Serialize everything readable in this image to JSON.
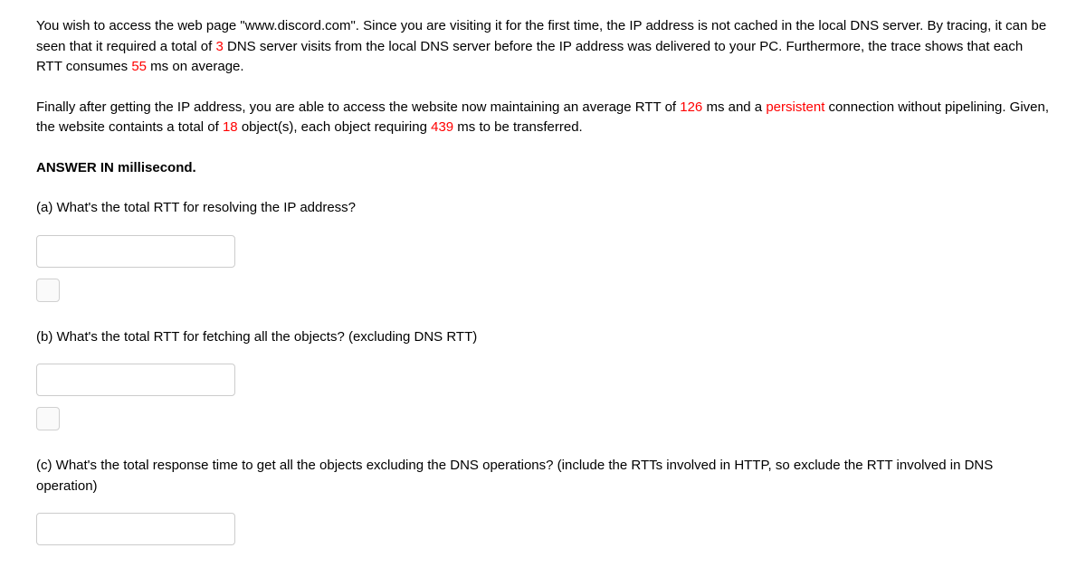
{
  "intro": {
    "p1_a": "You wish to access the web page \"www.discord.com\". Since you are visiting it for the first time, the IP address is not cached in the local DNS server. By tracing, it can be seen that it required a total of ",
    "dns_visits": "3",
    "p1_b": " DNS server visits from the local DNS server before the IP address was delivered to your PC. Furthermore, the trace shows that each RTT consumes ",
    "dns_rtt": "55",
    "p1_c": " ms on average.",
    "p2_a": "Finally after getting the IP address, you are able to access the website now maintaining an average RTT of ",
    "http_rtt": "126",
    "p2_b": " ms and a ",
    "persistent": "persistent",
    "p2_c": " connection without pipelining. Given, the website containts a total of ",
    "objects": "18",
    "p2_d": " object(s), each object requiring ",
    "transfer_ms": "439",
    "p2_e": " ms to be transferred.",
    "answer_in": "ANSWER IN millisecond."
  },
  "qa": {
    "text": "(a) What's the total RTT for resolving the IP address?"
  },
  "qb": {
    "text": "(b) What's the total RTT for fetching all the objects? (excluding DNS RTT)"
  },
  "qc": {
    "text": "(c) What's the total response time to get all the objects excluding the DNS operations? (include the RTTs involved in HTTP, so exclude the RTT involved in DNS operation)"
  }
}
